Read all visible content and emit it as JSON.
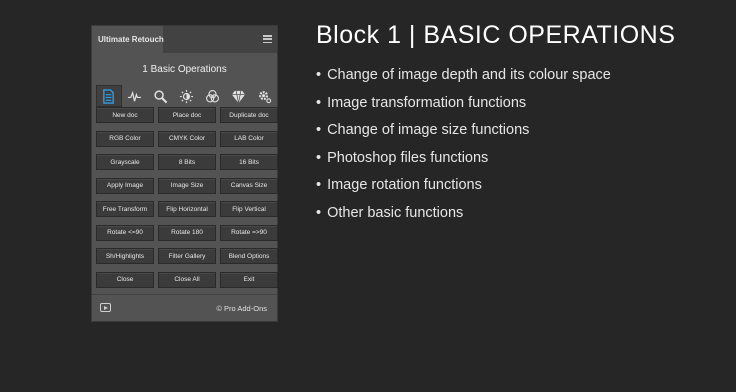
{
  "panel": {
    "tab_label": "Ultimate Retouch",
    "title": "1 Basic Operations",
    "toolbar": [
      {
        "icon": "document-icon",
        "active": true
      },
      {
        "icon": "waveform-icon",
        "active": false
      },
      {
        "icon": "magnifier-icon",
        "active": false
      },
      {
        "icon": "sun-brightness-icon",
        "active": false
      },
      {
        "icon": "color-circles-icon",
        "active": false
      },
      {
        "icon": "diamond-icon",
        "active": false
      },
      {
        "icon": "gear-icon",
        "active": false
      }
    ],
    "buttons": [
      "New doc",
      "Place doc",
      "Duplicate doc",
      "RGB Color",
      "CMYK Color",
      "LAB Color",
      "Grayscale",
      "8 Bits",
      "16 Bits",
      "Apply Image",
      "Image Size",
      "Canvas Size",
      "Free Transform",
      "Flip Horizontal",
      "Flip Vertical",
      "Rotate <=90",
      "Rotate 180",
      "Rotate =>90",
      "Sh/Highlights",
      "Filter Gallery",
      "Blend Options",
      "Close",
      "Close All",
      "Exit"
    ],
    "footer_credit": "© Pro Add-Ons"
  },
  "headline": "Block 1 | BASIC OPERATIONS",
  "features": [
    "Change of image depth  and its colour space",
    "Image transformation functions",
    "Change of image size functions",
    "Photoshop files functions",
    "Image rotation functions",
    "Other basic functions"
  ],
  "colors": {
    "background": "#262626",
    "panel": "#535353",
    "button": "#3b3b3b",
    "accent_blue": "#2f9be8"
  }
}
